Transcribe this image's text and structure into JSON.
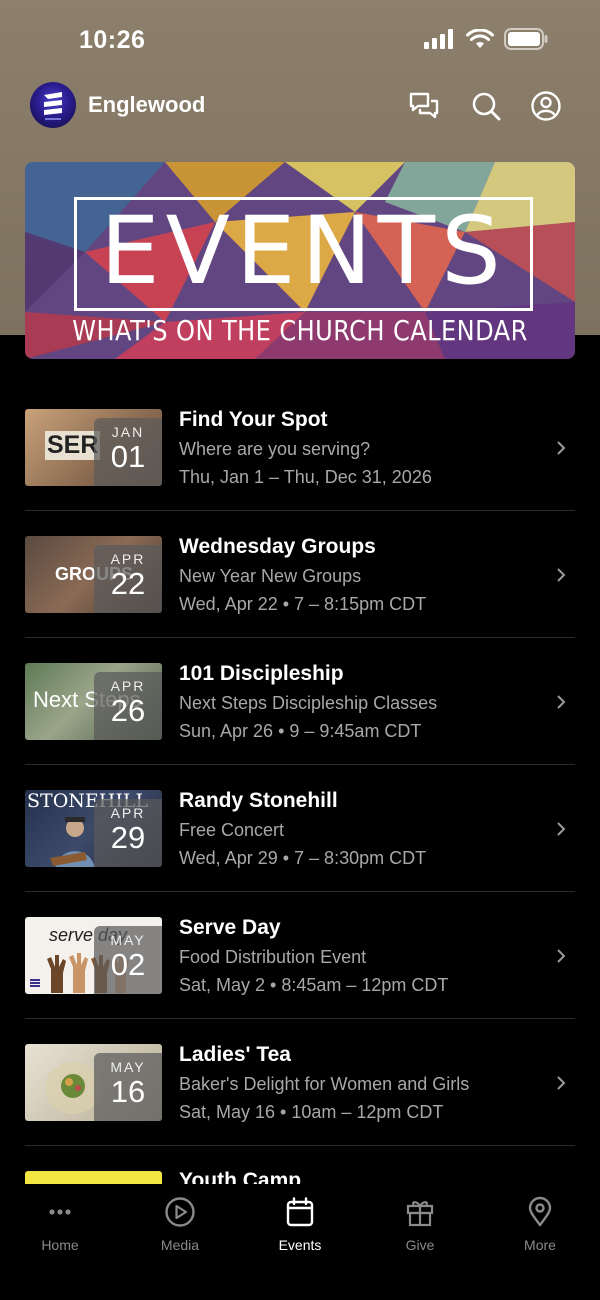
{
  "status_bar": {
    "time": "10:26"
  },
  "header": {
    "app_name": "Englewood"
  },
  "banner": {
    "title": "EVENTS",
    "subtitle": "WHAT'S ON THE CHURCH CALENDAR"
  },
  "events": [
    {
      "title": "Find Your Spot",
      "subtitle": "Where are you serving?",
      "date": "Thu, Jan 1 – Thu, Dec 31, 2026",
      "month": "JAN",
      "day": "01",
      "thumb_text": "SER"
    },
    {
      "title": "Wednesday Groups",
      "subtitle": "New Year New Groups",
      "date": "Wed, Apr 22 • 7 – 8:15pm CDT",
      "month": "APR",
      "day": "22",
      "thumb_text": "GROUPS"
    },
    {
      "title": "101 Discipleship",
      "subtitle": "Next Steps Discipleship Classes",
      "date": "Sun, Apr 26 • 9 – 9:45am CDT",
      "month": "APR",
      "day": "26",
      "thumb_text": "Next Steps"
    },
    {
      "title": "Randy Stonehill",
      "subtitle": "Free Concert",
      "date": "Wed, Apr 29 • 7 – 8:30pm CDT",
      "month": "APR",
      "day": "29",
      "thumb_text": "STONEHILL"
    },
    {
      "title": "Serve Day",
      "subtitle": "Food Distribution Event",
      "date": "Sat, May 2 • 8:45am – 12pm CDT",
      "month": "MAY",
      "day": "02",
      "thumb_text": "serve day"
    },
    {
      "title": "Ladies' Tea",
      "subtitle": "Baker's Delight for Women and Girls",
      "date": "Sat, May 16 • 10am – 12pm CDT",
      "month": "MAY",
      "day": "16",
      "thumb_text": ""
    }
  ],
  "partial_event": {
    "title": "Youth Camp"
  },
  "tabs": [
    {
      "label": "Home",
      "icon": "more-dots-icon",
      "active": false
    },
    {
      "label": "Media",
      "icon": "play-circle-icon",
      "active": false
    },
    {
      "label": "Events",
      "icon": "calendar-icon",
      "active": true
    },
    {
      "label": "Give",
      "icon": "gift-icon",
      "active": false
    },
    {
      "label": "More",
      "icon": "location-pin-icon",
      "active": false
    }
  ],
  "colors": {
    "background": "#000000",
    "header_bg": "#8c7f6b",
    "secondary_text": "#a8a8a8",
    "divider": "#2b2b2b"
  }
}
